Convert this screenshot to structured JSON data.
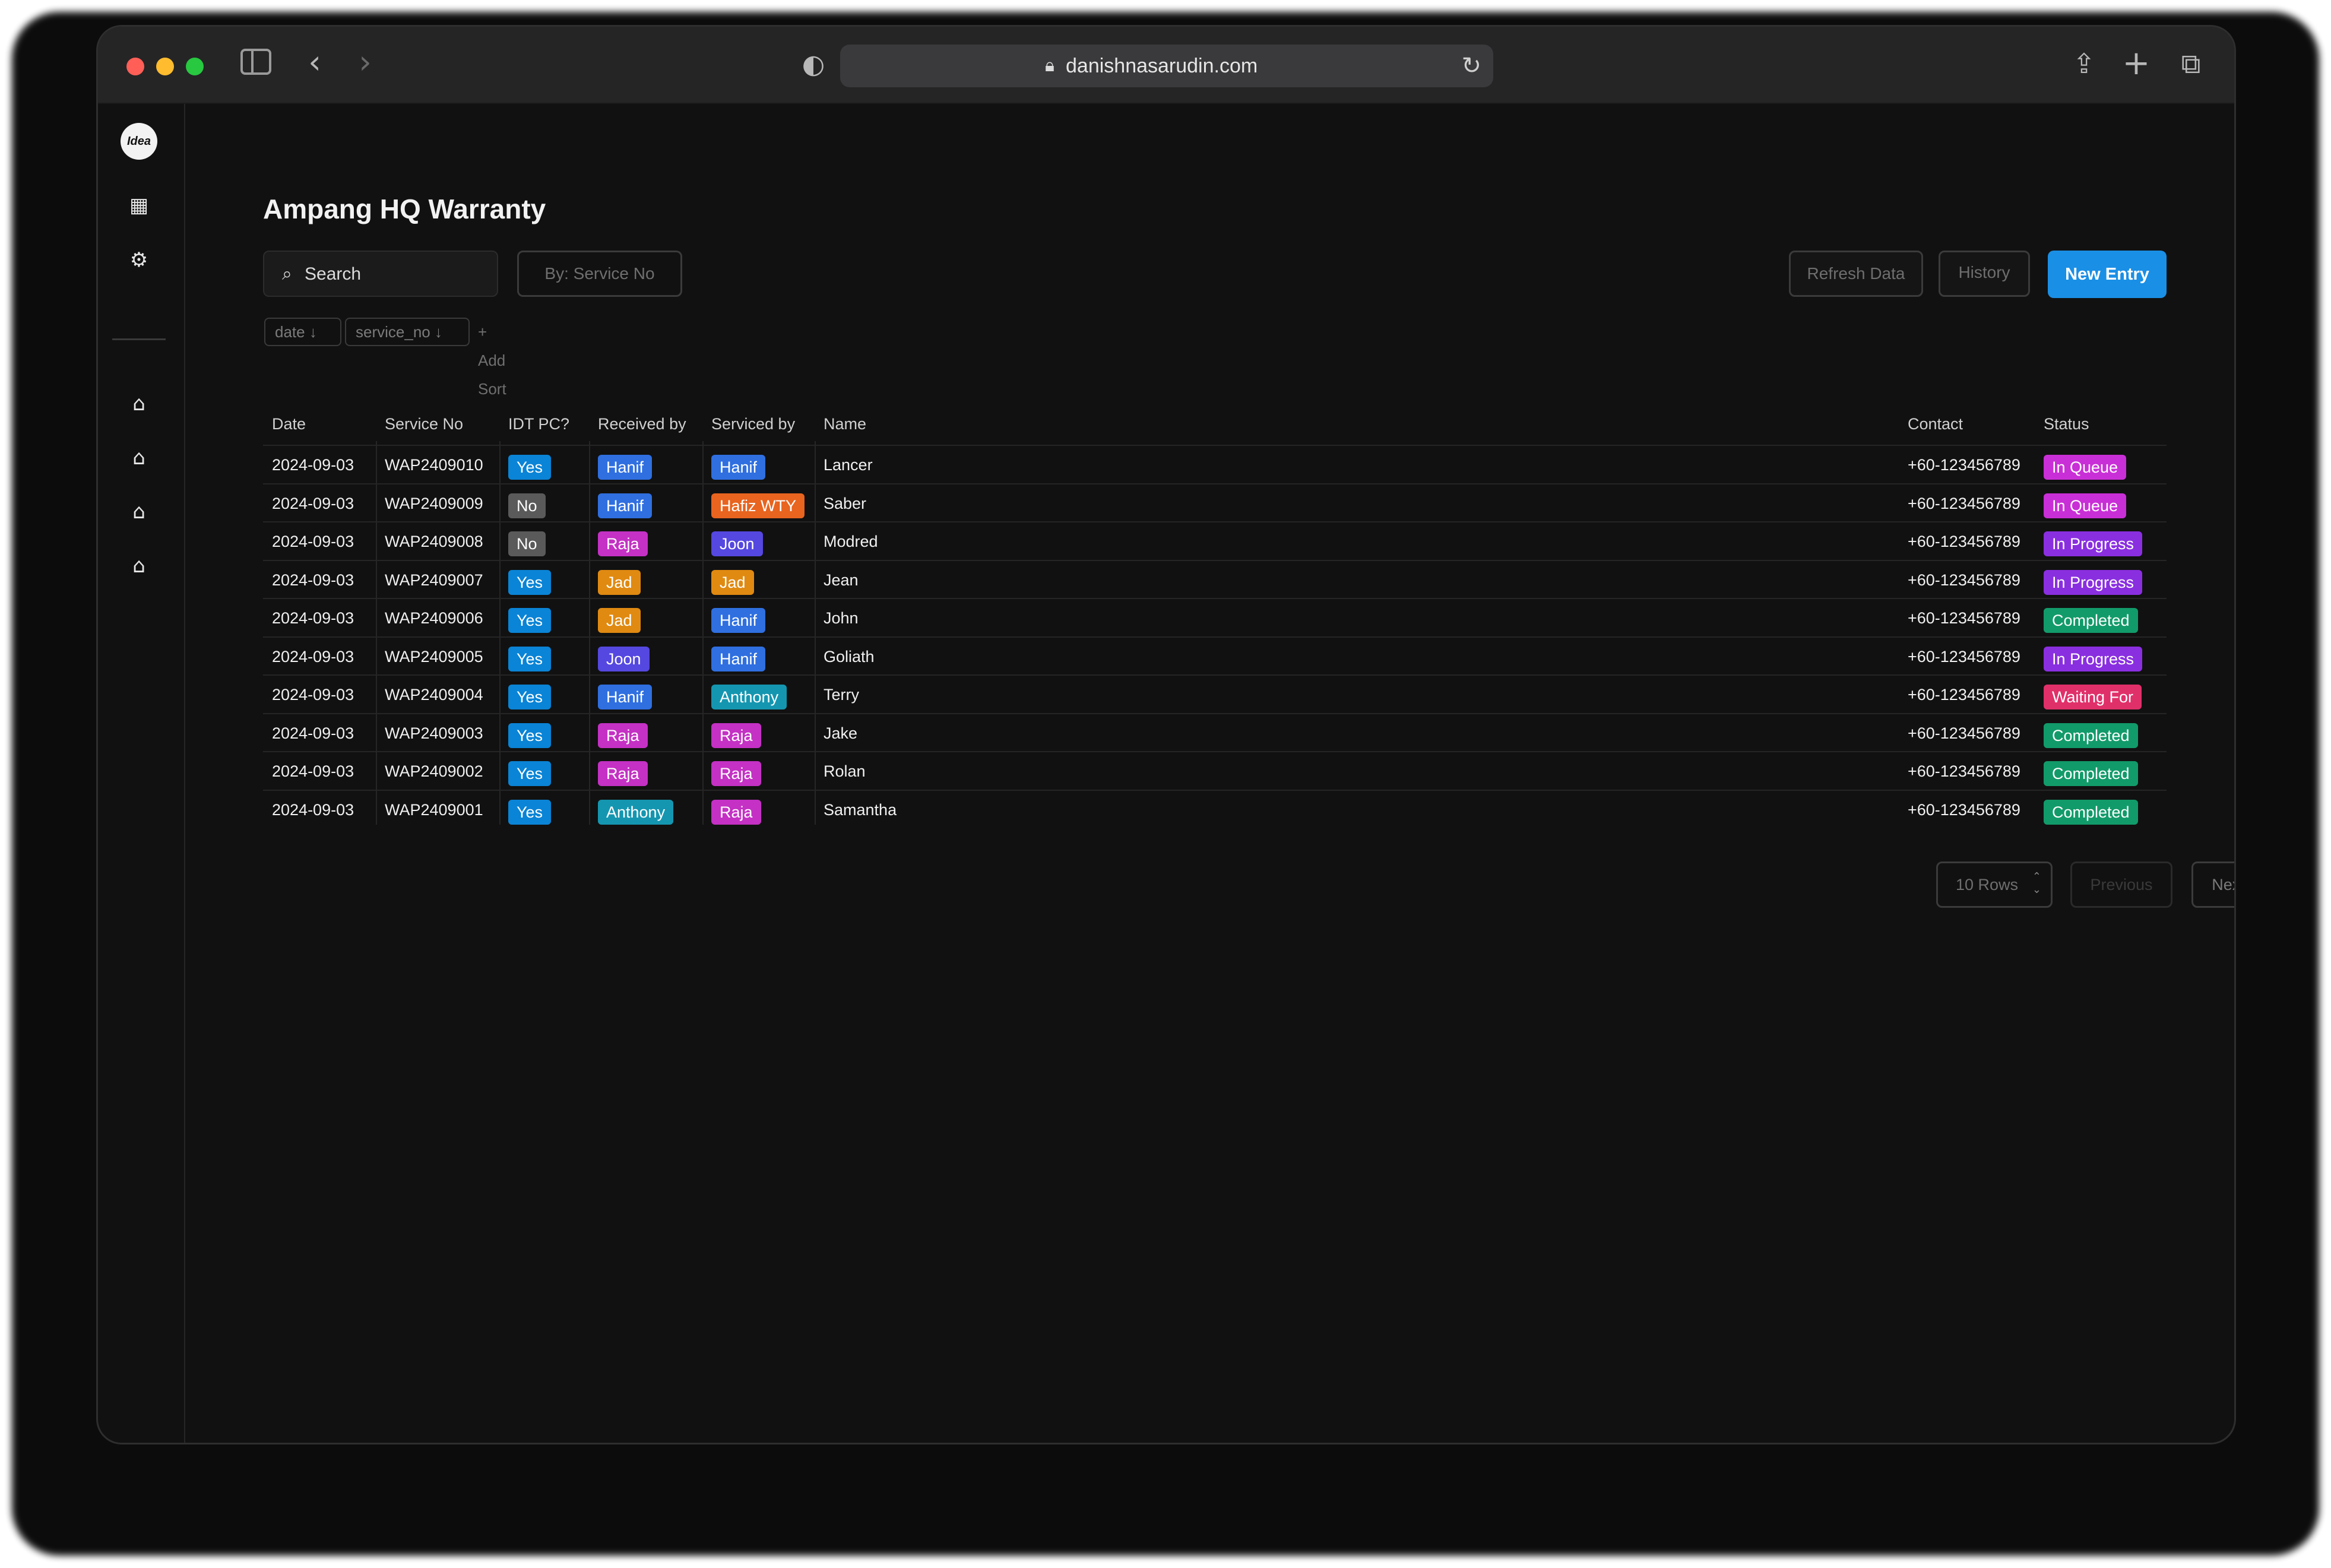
{
  "browser": {
    "url": "danishnasarudin.com"
  },
  "app": {
    "logo_text": "Idea"
  },
  "page": {
    "title": "Ampang HQ Warranty",
    "search_placeholder": "Search",
    "filter_by": "By: Service No",
    "refresh_label": "Refresh Data",
    "history_label": "History",
    "new_entry_label": "New Entry",
    "sort_chips": [
      "date ↓",
      "service_no ↓"
    ],
    "add_sort_label": "+ Add Sort"
  },
  "table": {
    "headers": [
      "Date",
      "Service No",
      "IDT PC?",
      "Received by",
      "Serviced by",
      "Name",
      "Contact",
      "Status"
    ],
    "rows": [
      {
        "date": "2024-09-03",
        "service_no": "WAP2409010",
        "idt": "Yes",
        "received": "Hanif",
        "serviced": "Hanif",
        "name": "Lancer",
        "contact": "+60-123456789",
        "status": "In Queue"
      },
      {
        "date": "2024-09-03",
        "service_no": "WAP2409009",
        "idt": "No",
        "received": "Hanif",
        "serviced": "Hafiz WTY",
        "name": "Saber",
        "contact": "+60-123456789",
        "status": "In Queue"
      },
      {
        "date": "2024-09-03",
        "service_no": "WAP2409008",
        "idt": "No",
        "received": "Raja",
        "serviced": "Joon",
        "name": "Modred",
        "contact": "+60-123456789",
        "status": "In Progress"
      },
      {
        "date": "2024-09-03",
        "service_no": "WAP2409007",
        "idt": "Yes",
        "received": "Jad",
        "serviced": "Jad",
        "name": "Jean",
        "contact": "+60-123456789",
        "status": "In Progress"
      },
      {
        "date": "2024-09-03",
        "service_no": "WAP2409006",
        "idt": "Yes",
        "received": "Jad",
        "serviced": "Hanif",
        "name": "John",
        "contact": "+60-123456789",
        "status": "Completed"
      },
      {
        "date": "2024-09-03",
        "service_no": "WAP2409005",
        "idt": "Yes",
        "received": "Joon",
        "serviced": "Hanif",
        "name": "Goliath",
        "contact": "+60-123456789",
        "status": "In Progress"
      },
      {
        "date": "2024-09-03",
        "service_no": "WAP2409004",
        "idt": "Yes",
        "received": "Hanif",
        "serviced": "Anthony",
        "name": "Terry",
        "contact": "+60-123456789",
        "status": "Waiting For"
      },
      {
        "date": "2024-09-03",
        "service_no": "WAP2409003",
        "idt": "Yes",
        "received": "Raja",
        "serviced": "Raja",
        "name": "Jake",
        "contact": "+60-123456789",
        "status": "Completed"
      },
      {
        "date": "2024-09-03",
        "service_no": "WAP2409002",
        "idt": "Yes",
        "received": "Raja",
        "serviced": "Raja",
        "name": "Rolan",
        "contact": "+60-123456789",
        "status": "Completed"
      },
      {
        "date": "2024-09-03",
        "service_no": "WAP2409001",
        "idt": "Yes",
        "received": "Anthony",
        "serviced": "Raja",
        "name": "Samantha",
        "contact": "+60-123456789",
        "status": "Completed"
      }
    ]
  },
  "pagination": {
    "rows_label": "10 Rows",
    "previous_label": "Previous",
    "next_label": "Next"
  },
  "colors": {
    "Yes": "#0a84d6",
    "No": "#5a5a5a",
    "Hanif": "#2f6fe0",
    "Hafiz WTY": "#e8641f",
    "Raja": "#c431c4",
    "Joon": "#5548e0",
    "Jad": "#e08a12",
    "Anthony": "#1596b0",
    "In Queue": "#c92fd6",
    "In Progress": "#8a2fe0",
    "Completed": "#129b6a",
    "Waiting For": "#e0306a",
    "accent": "#1a8fe6"
  }
}
